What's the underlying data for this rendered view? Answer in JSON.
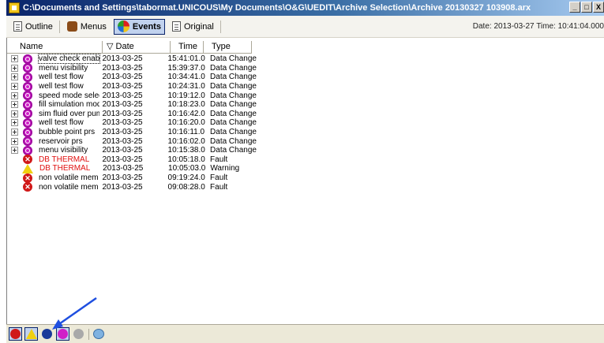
{
  "window": {
    "title": "C:\\Documents and Settings\\tabormat.UNICOUS\\My Documents\\O&G\\UEDIT\\Archive Selection\\Archive 20130327 103908.arx",
    "min_label": "_",
    "max_label": "□",
    "close_label": "X"
  },
  "toolbar": {
    "outline_label": "Outline",
    "menus_label": "Menus",
    "events_label": "Events",
    "original_label": "Original",
    "date_time": "Date: 2013-03-27  Time: 10:41:04.000"
  },
  "table": {
    "columns": [
      "Name",
      "Date",
      "Time",
      "Type"
    ],
    "rows": [
      {
        "icon": "data-change-icon",
        "expandable": true,
        "name": "valve check enable",
        "date": "2013-03-25",
        "time": "15:41:01.0",
        "type": "Data Change",
        "highlight": false
      },
      {
        "icon": "data-change-icon",
        "expandable": true,
        "name": "menu visibility",
        "date": "2013-03-25",
        "time": "15:39:37.0",
        "type": "Data Change",
        "highlight": false
      },
      {
        "icon": "data-change-icon",
        "expandable": true,
        "name": "well test flow",
        "date": "2013-03-25",
        "time": "10:34:41.0",
        "type": "Data Change",
        "highlight": false
      },
      {
        "icon": "data-change-icon",
        "expandable": true,
        "name": "well test flow",
        "date": "2013-03-25",
        "time": "10:24:31.0",
        "type": "Data Change",
        "highlight": false
      },
      {
        "icon": "data-change-icon",
        "expandable": true,
        "name": "speed mode select",
        "date": "2013-03-25",
        "time": "10:19:12.0",
        "type": "Data Change",
        "highlight": false
      },
      {
        "icon": "data-change-icon",
        "expandable": true,
        "name": "fill simulation mode",
        "date": "2013-03-25",
        "time": "10:18:23.0",
        "type": "Data Change",
        "highlight": false
      },
      {
        "icon": "data-change-icon",
        "expandable": true,
        "name": "sim fluid over pump",
        "date": "2013-03-25",
        "time": "10:16:42.0",
        "type": "Data Change",
        "highlight": false
      },
      {
        "icon": "data-change-icon",
        "expandable": true,
        "name": "well test flow",
        "date": "2013-03-25",
        "time": "10:16:20.0",
        "type": "Data Change",
        "highlight": false
      },
      {
        "icon": "data-change-icon",
        "expandable": true,
        "name": "bubble point prs",
        "date": "2013-03-25",
        "time": "10:16:11.0",
        "type": "Data Change",
        "highlight": false
      },
      {
        "icon": "data-change-icon",
        "expandable": true,
        "name": "reservoir prs",
        "date": "2013-03-25",
        "time": "10:16:02.0",
        "type": "Data Change",
        "highlight": false
      },
      {
        "icon": "data-change-icon",
        "expandable": true,
        "name": "menu visibility",
        "date": "2013-03-25",
        "time": "10:15:38.0",
        "type": "Data Change",
        "highlight": false
      },
      {
        "icon": "fault-icon",
        "expandable": false,
        "name": "DB THERMAL",
        "date": "2013-03-25",
        "time": "10:05:18.0",
        "type": "Fault",
        "highlight": true
      },
      {
        "icon": "warning-icon",
        "expandable": false,
        "name": "DB THERMAL",
        "date": "2013-03-25",
        "time": "10:05:03.0",
        "type": "Warning",
        "highlight": true
      },
      {
        "icon": "fault-icon",
        "expandable": false,
        "name": "non volatile mem",
        "date": "2013-03-25",
        "time": "09:19:24.0",
        "type": "Fault",
        "highlight": false
      },
      {
        "icon": "fault-icon",
        "expandable": false,
        "name": "non volatile mem",
        "date": "2013-03-25",
        "time": "09:08:28.0",
        "type": "Fault",
        "highlight": false
      }
    ]
  },
  "statusbar": {
    "filters": [
      "fault-filter-icon",
      "warning-filter-icon",
      "info-filter-icon",
      "data-change-filter-icon",
      "disabled-filter-icon",
      "network-icon"
    ]
  },
  "colors": {
    "accent": "#0a246a",
    "fault": "#d01818",
    "warning": "#f0d010",
    "data_change": "#d020c8",
    "highlight_text": "#e01010",
    "annotation_arrow": "#1f4fe0"
  }
}
